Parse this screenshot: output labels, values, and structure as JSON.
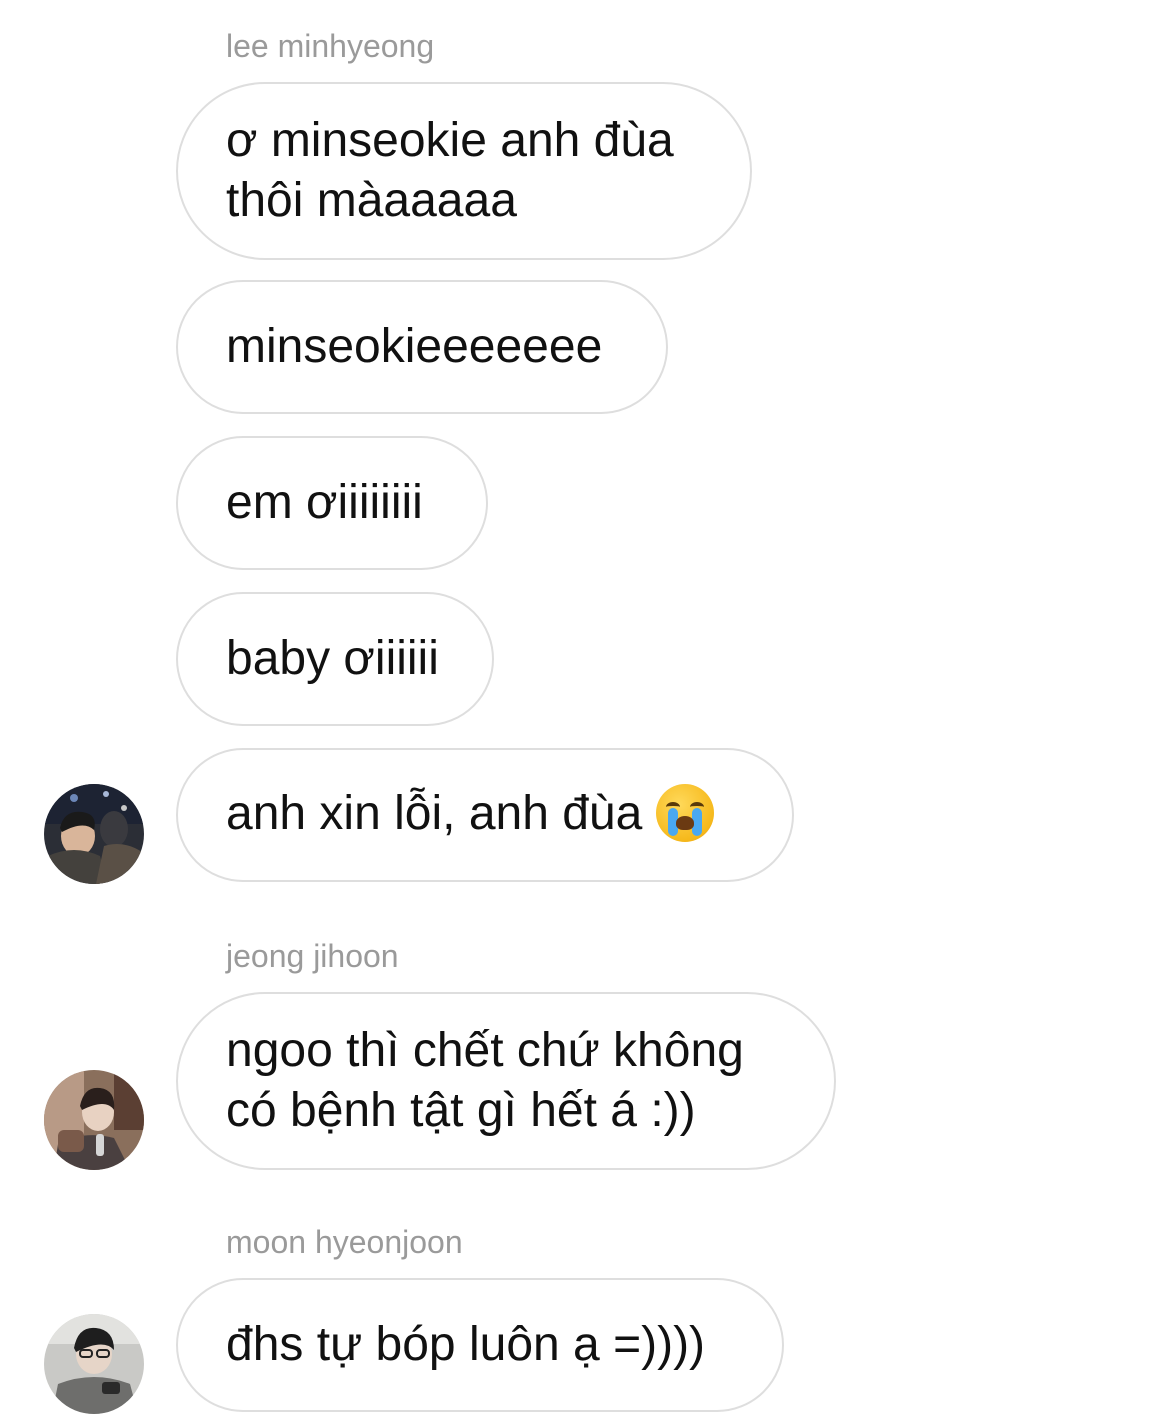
{
  "senders": {
    "first": "lee minhyeong",
    "second": "jeong jihoon",
    "third": "moon hyeonjoon"
  },
  "messages": {
    "m1": {
      "line1": "ơ minseokie anh đùa",
      "line2": "thôi màaaaaa"
    },
    "m2": "minseokieeeeeee",
    "m3": "em ơiiiiiiii",
    "m4": "baby ơiiiiii",
    "m5": "anh xin lỗi, anh đùa",
    "m6": {
      "line1": "ngoo thì chết chứ không",
      "line2": "có bệnh tật gì hết á :))"
    },
    "m7": "đhs tự bóp luôn ạ =))))"
  },
  "icons": {
    "crying_emoji": "loudly-crying-face-icon"
  },
  "colors": {
    "bubble_border": "#dedede",
    "sender_name": "#9a9a9a",
    "message_text": "#111111"
  }
}
